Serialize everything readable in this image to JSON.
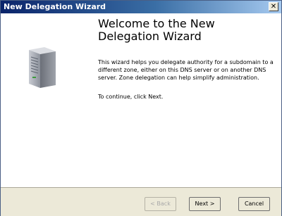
{
  "window": {
    "title": "New Delegation Wizard",
    "close_glyph": "✕"
  },
  "content": {
    "heading": "Welcome to the New Delegation Wizard",
    "description": "This wizard helps you delegate authority for a subdomain to a different zone, either on this DNS server or on another DNS server. Zone delegation can help simplify administration.",
    "continue_text": "To continue, click Next."
  },
  "buttons": {
    "back": "< Back",
    "next": "Next >",
    "cancel": "Cancel"
  },
  "icons": {
    "wizard_graphic": "server-icon"
  }
}
